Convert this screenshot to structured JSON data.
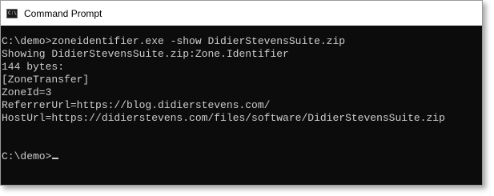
{
  "window": {
    "title": "Command Prompt",
    "icon": "cmd-icon"
  },
  "console": {
    "background_color": "#0c0c0c",
    "text_color": "#cccccc",
    "lines": [
      "C:\\demo>zoneidentifier.exe -show DidierStevensSuite.zip",
      "Showing DidierStevensSuite.zip:Zone.Identifier",
      "144 bytes:",
      "[ZoneTransfer]",
      "ZoneId=3",
      "ReferrerUrl=https://blog.didierstevens.com/",
      "HostUrl=https://didierstevens.com/files/software/DidierStevensSuite.zip",
      "",
      "",
      "C:\\demo>"
    ]
  }
}
